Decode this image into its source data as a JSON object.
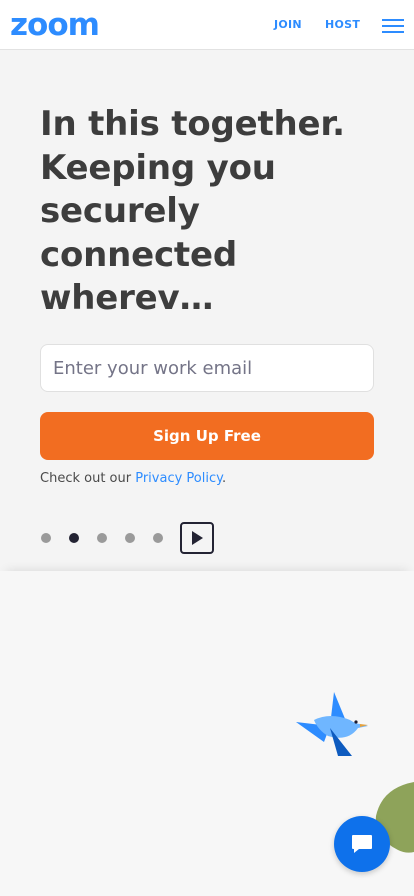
{
  "header": {
    "logo_text": "zoom",
    "join_label": "JOIN",
    "host_label": "HOST",
    "menu_icon": "hamburger-menu-icon"
  },
  "hero": {
    "title": "In this together. Keeping you securely connected wherev…"
  },
  "signup": {
    "email_placeholder": "Enter your work email",
    "email_value": "",
    "button_label": "Sign Up Free",
    "privacy_prefix": "Check out our ",
    "privacy_link": "Privacy Policy",
    "privacy_suffix": "."
  },
  "carousel": {
    "slide_count": 5,
    "active_index": 1,
    "play_icon": "play-icon"
  },
  "decor": {
    "bird_icon": "bird-illustration",
    "blob_icon": "green-blob-illustration"
  },
  "chat": {
    "icon": "chat-bubble-icon"
  },
  "colors": {
    "brand_blue": "#2d8cff",
    "signup_orange": "#f26d21",
    "chat_blue": "#0e71eb",
    "text_dark": "#3d3d3d"
  }
}
